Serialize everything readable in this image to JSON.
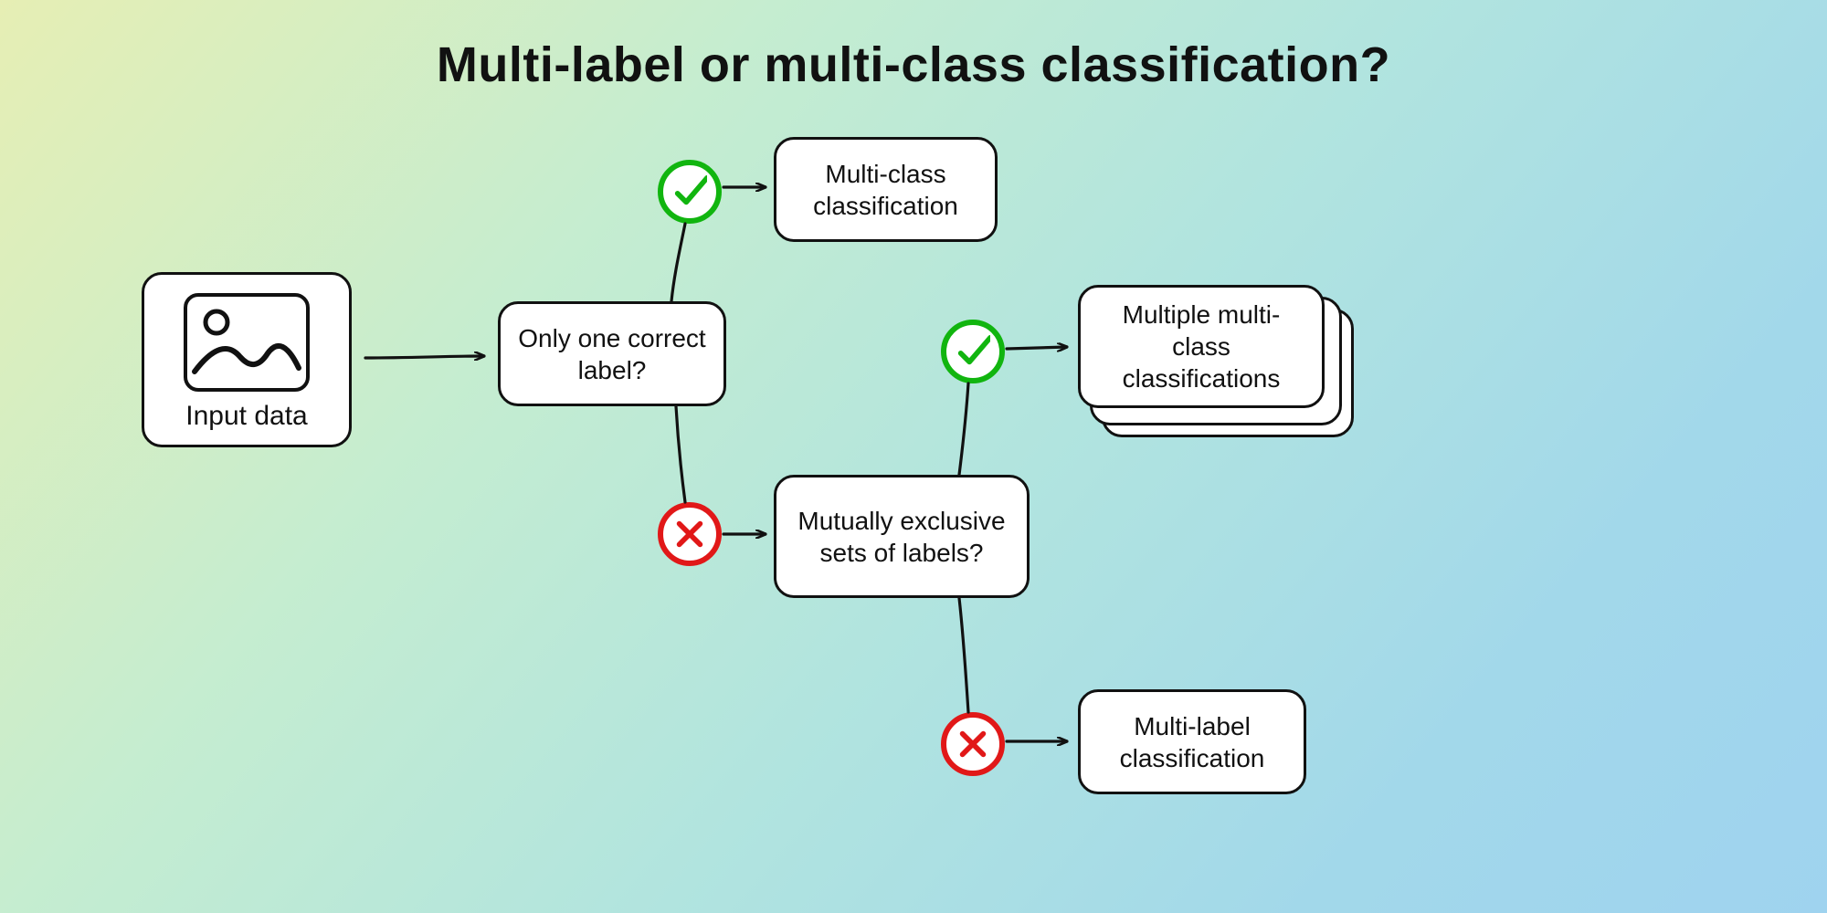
{
  "title": "Multi-label or multi-class classification?",
  "nodes": {
    "input": "Input data",
    "decision1": "Only one correct label?",
    "leaf_multiclass": "Multi-class classification",
    "decision2": "Mutually exclusive sets of labels?",
    "leaf_multiple": "Multiple multi-class classifications",
    "leaf_multilabel": "Multi-label classification"
  },
  "edges": {
    "yes": "yes",
    "no": "no"
  },
  "icons": {
    "check": "check-icon",
    "cross": "cross-icon",
    "image": "image-icon",
    "arrow": "arrow-icon"
  },
  "colors": {
    "green": "#11b50f",
    "red": "#e11818",
    "stroke": "#111111"
  }
}
